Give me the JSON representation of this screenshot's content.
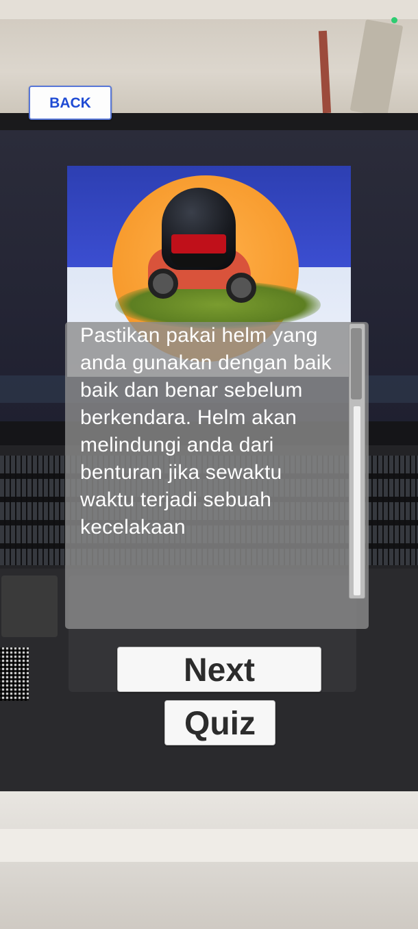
{
  "nav": {
    "back_label": "BACK"
  },
  "content": {
    "paragraph": "Pastikan pakai helm yang anda gunakan dengan baik baik dan benar sebelum berkendara. Helm akan melindungi anda dari benturan jika sewaktu waktu terjadi sebuah kecelakaan"
  },
  "actions": {
    "next_label": "Next",
    "quiz_label": "Quiz"
  },
  "icons": [
    "helmet-image",
    "motorcycle-image"
  ],
  "colors": {
    "back_text": "#1f4bd4",
    "panel_bg": "#8c8c8c",
    "button_bg": "#f7f7f7"
  }
}
